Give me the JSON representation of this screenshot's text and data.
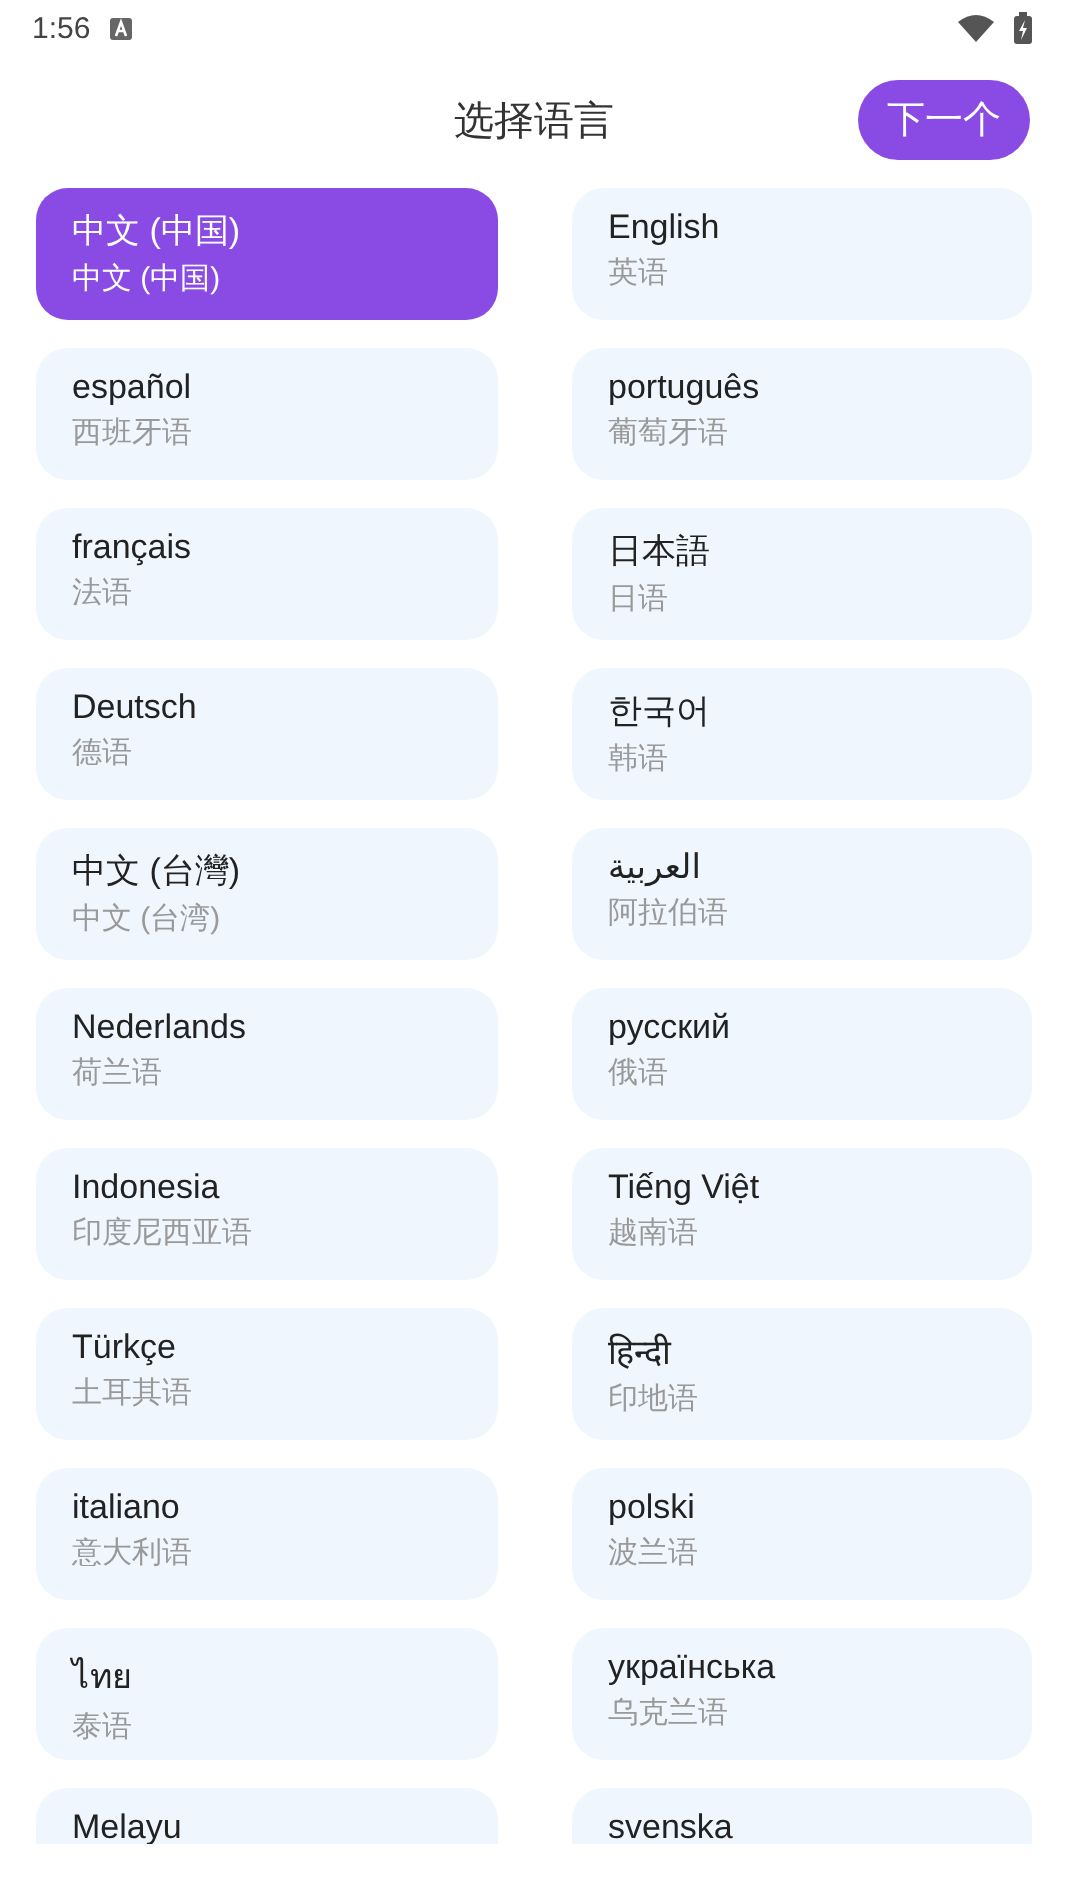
{
  "status_bar": {
    "time": "1:56"
  },
  "header": {
    "title": "选择语言",
    "next_button": "下一个"
  },
  "languages": [
    {
      "name": "中文 (中国)",
      "subtitle": "中文 (中国)",
      "selected": true
    },
    {
      "name": "English",
      "subtitle": "英语",
      "selected": false
    },
    {
      "name": "español",
      "subtitle": "西班牙语",
      "selected": false
    },
    {
      "name": "português",
      "subtitle": "葡萄牙语",
      "selected": false
    },
    {
      "name": "français",
      "subtitle": "法语",
      "selected": false
    },
    {
      "name": "日本語",
      "subtitle": "日语",
      "selected": false
    },
    {
      "name": "Deutsch",
      "subtitle": "德语",
      "selected": false
    },
    {
      "name": "한국어",
      "subtitle": "韩语",
      "selected": false
    },
    {
      "name": "中文 (台灣)",
      "subtitle": "中文 (台湾)",
      "selected": false
    },
    {
      "name": "العربية",
      "subtitle": "阿拉伯语",
      "selected": false
    },
    {
      "name": "Nederlands",
      "subtitle": "荷兰语",
      "selected": false
    },
    {
      "name": "русский",
      "subtitle": "俄语",
      "selected": false
    },
    {
      "name": "Indonesia",
      "subtitle": "印度尼西亚语",
      "selected": false
    },
    {
      "name": "Tiếng Việt",
      "subtitle": "越南语",
      "selected": false
    },
    {
      "name": "Türkçe",
      "subtitle": "土耳其语",
      "selected": false
    },
    {
      "name": "हिन्दी",
      "subtitle": "印地语",
      "selected": false
    },
    {
      "name": "italiano",
      "subtitle": "意大利语",
      "selected": false
    },
    {
      "name": "polski",
      "subtitle": "波兰语",
      "selected": false
    },
    {
      "name": "ไทย",
      "subtitle": "泰语",
      "selected": false
    },
    {
      "name": "українська",
      "subtitle": "乌克兰语",
      "selected": false
    },
    {
      "name": "Melayu",
      "selected": false
    },
    {
      "name": "svenska",
      "selected": false
    }
  ]
}
